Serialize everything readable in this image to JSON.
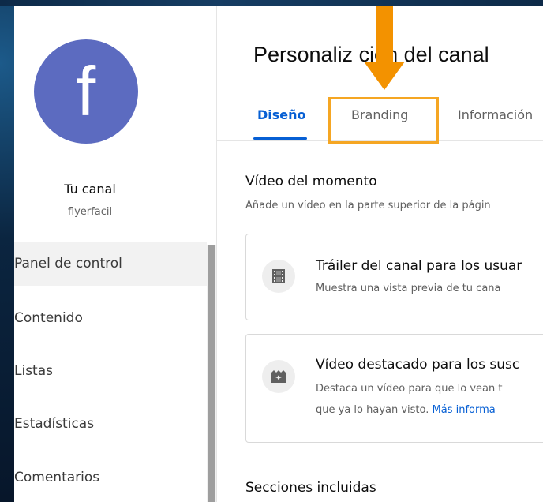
{
  "sidebar": {
    "avatar_letter": "f",
    "avatar_color": "#5c6bc0",
    "channel_label": "Tu canal",
    "channel_handle": "flyerfacil",
    "items": [
      {
        "label": "Panel de control",
        "active": true
      },
      {
        "label": "Contenido"
      },
      {
        "label": "Listas"
      },
      {
        "label": "Estadísticas"
      },
      {
        "label": "Comentarios"
      }
    ]
  },
  "main": {
    "title": "Personaliz  ción del canal",
    "tabs": [
      {
        "label": "Diseño",
        "active": true
      },
      {
        "label": "Branding"
      },
      {
        "label": "Información"
      }
    ],
    "featured": {
      "title": "Vídeo del momento",
      "description": "Añade un vídeo en la parte superior de la págin"
    },
    "cards": [
      {
        "icon": "film-icon",
        "title": "Tráiler del canal para los usuar",
        "description": "Muestra una vista previa de tu cana"
      },
      {
        "icon": "sparkle-video-icon",
        "title": "Vídeo destacado para los susc",
        "description_line1": "Destaca un vídeo para que lo vean t",
        "description_line2": "que ya lo hayan visto.",
        "link": "Más informa"
      }
    ],
    "sections_title": "Secciones incluidas"
  },
  "annotation": {
    "highlight_color": "#f5a623",
    "arrow_color": "#f39200"
  },
  "colors": {
    "accent": "#065fd4"
  }
}
